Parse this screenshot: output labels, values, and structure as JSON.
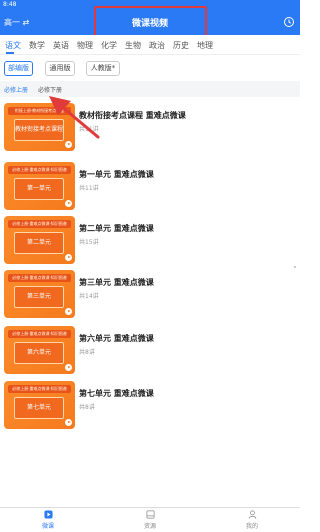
{
  "status_bar": {
    "time": "8:48"
  },
  "header": {
    "grade_label": "高一 ⇄",
    "title": "微课视频"
  },
  "subjects": [
    {
      "label": "语文",
      "active": true
    },
    {
      "label": "数学",
      "active": false
    },
    {
      "label": "英语",
      "active": false
    },
    {
      "label": "物理",
      "active": false
    },
    {
      "label": "化学",
      "active": false
    },
    {
      "label": "生物",
      "active": false
    },
    {
      "label": "政治",
      "active": false
    },
    {
      "label": "历史",
      "active": false
    },
    {
      "label": "地理",
      "active": false
    }
  ],
  "versions": [
    {
      "label": "部编版",
      "active": true
    },
    {
      "label": "通用版",
      "active": false
    },
    {
      "label": "人教版*",
      "active": false
    }
  ],
  "volumes": [
    {
      "label": "必修上册",
      "active": true
    },
    {
      "label": "必修下册",
      "active": false
    }
  ],
  "courses": [
    {
      "title": "教材衔接考点课程 重难点微课",
      "count": "共11讲",
      "thumb_strip": "衔接上册·教材衔接考点课程",
      "thumb_banner": "教材衔接考点课程"
    },
    {
      "title": "第一单元 重难点微课",
      "count": "共11讲",
      "thumb_strip": "必修上册·重难点微课·知识图谱",
      "thumb_banner": "第一单元"
    },
    {
      "title": "第二单元 重难点微课",
      "count": "共15讲",
      "thumb_strip": "必修上册·重难点微课·知识图谱",
      "thumb_banner": "第二单元"
    },
    {
      "title": "第三单元 重难点微课",
      "count": "共14讲",
      "thumb_strip": "必修上册·重难点微课·知识图谱",
      "thumb_banner": "第三单元"
    },
    {
      "title": "第六单元 重难点微课",
      "count": "共8讲",
      "thumb_strip": "必修上册·重难点微课·知识图谱",
      "thumb_banner": "第六单元"
    },
    {
      "title": "第七单元 重难点微课",
      "count": "共8讲",
      "thumb_strip": "必修上册·重难点微课·知识图谱",
      "thumb_banner": "第七单元"
    }
  ],
  "tabbar": [
    {
      "label": "微课",
      "icon": "play-icon",
      "active": true
    },
    {
      "label": "资源",
      "icon": "book-icon",
      "active": false
    },
    {
      "label": "我的",
      "icon": "person-icon",
      "active": false
    }
  ],
  "colors": {
    "primary": "#2a7af5",
    "annotation": "#e03a3a",
    "thumb_orange": "#f57a1e"
  }
}
